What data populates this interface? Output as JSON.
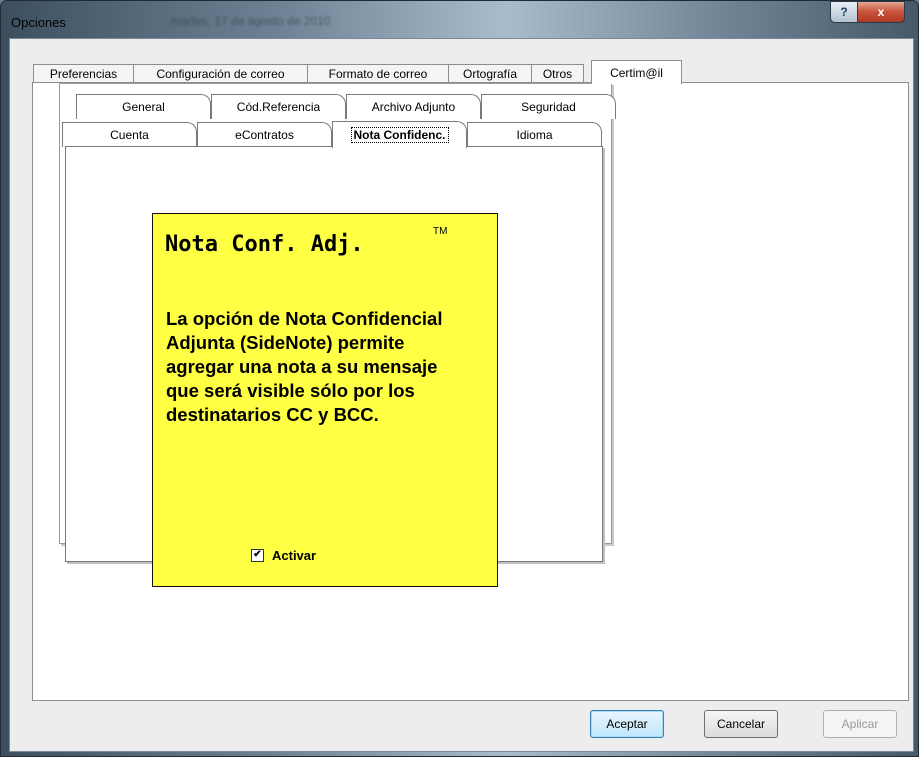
{
  "window": {
    "title": "Opciones",
    "ghost_text": "martes, 17 de agosto de 2010",
    "help_label": "?",
    "close_label": "x"
  },
  "outer_tabs": [
    "Preferencias",
    "Configuración de correo",
    "Formato de correo",
    "Ortografía",
    "Otros",
    "Certim@il"
  ],
  "inner_tabs_row1": [
    "General",
    "Cód.Referencia",
    "Archivo Adjunto",
    "Seguridad"
  ],
  "inner_tabs_row2": [
    "Cuenta",
    "eContratos",
    "Nota Confidenc.",
    "Idioma"
  ],
  "note": {
    "title": "Nota Conf. Adj.",
    "trademark": "TM",
    "body": "La opción de Nota Confidencial Adjunta (SideNote) permite agregar una nota a su mensaje que será visible sólo por los destinatarios CC y BCC.",
    "checkbox_label": "Activar",
    "checkbox_checked": true,
    "background_color": "#ffff44"
  },
  "buttons": {
    "accept": "Aceptar",
    "cancel": "Cancelar",
    "apply": "Aplicar"
  }
}
